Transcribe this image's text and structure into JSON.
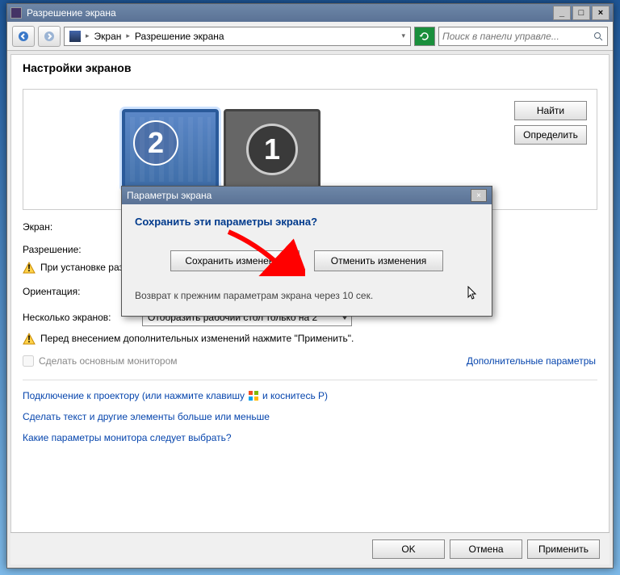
{
  "window": {
    "title": "Разрешение экрана"
  },
  "toolbar": {
    "breadcrumb": [
      "Экран",
      "Разрешение экрана"
    ],
    "search_placeholder": "Поиск в панели управле..."
  },
  "content": {
    "heading": "Настройки экранов",
    "find_btn": "Найти",
    "detect_btn": "Определить",
    "monitors": [
      {
        "num": "2",
        "selected": true
      },
      {
        "num": "1",
        "selected": false
      }
    ],
    "labels": {
      "screen": "Экран:",
      "resolution": "Разрешение:",
      "orientation": "Ориентация:",
      "multiple": "Несколько экранов:"
    },
    "warn_resolution": "При установке разрешения тся на экран.",
    "multiple_value": "Отобразить рабочий стол только на 2",
    "warn_apply": "Перед внесением дополнительных изменений нажмите \"Применить\".",
    "make_main": "Сделать основным монитором",
    "adv_link": "Дополнительные параметры",
    "links": [
      "Подключение к проектору (или нажмите клавишу",
      "и коснитесь Р)",
      "Сделать текст и другие элементы больше или меньше",
      "Какие параметры монитора следует выбрать?"
    ]
  },
  "modal": {
    "title": "Параметры экрана",
    "question": "Сохранить эти параметры экрана?",
    "save_btn": "Сохранить изменения",
    "revert_btn": "Отменить изменения",
    "footer": "Возврат к прежним параметрам экрана через 10 сек."
  },
  "bottom": {
    "ok": "OK",
    "cancel": "Отмена",
    "apply": "Применить"
  }
}
